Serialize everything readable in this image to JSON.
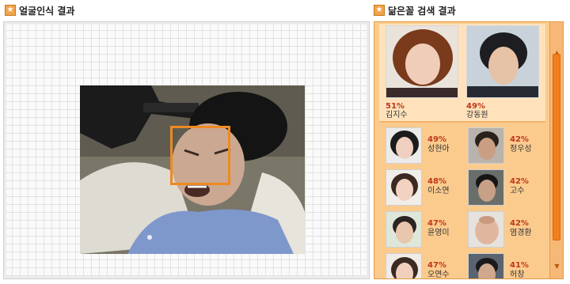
{
  "header_left": {
    "title": "얼굴인식 결과",
    "icon": "star-icon"
  },
  "header_right": {
    "title": "닮은꼴 검색 결과",
    "icon": "star-icon"
  },
  "colors": {
    "accent": "#ee8a22",
    "percent": "#c0371c",
    "results_bg": "#fbcb8e",
    "top_results_bg": "#ffe2bb"
  },
  "top_matches": [
    {
      "percent": "51%",
      "name": "김지수"
    },
    {
      "percent": "49%",
      "name": "강동원"
    }
  ],
  "matches": [
    {
      "percent": "49%",
      "name": "성현아"
    },
    {
      "percent": "42%",
      "name": "정우성"
    },
    {
      "percent": "48%",
      "name": "이소연"
    },
    {
      "percent": "42%",
      "name": "고수"
    },
    {
      "percent": "47%",
      "name": "윤영미"
    },
    {
      "percent": "42%",
      "name": "염경환"
    },
    {
      "percent": "47%",
      "name": "오연수"
    },
    {
      "percent": "41%",
      "name": "허창"
    }
  ]
}
